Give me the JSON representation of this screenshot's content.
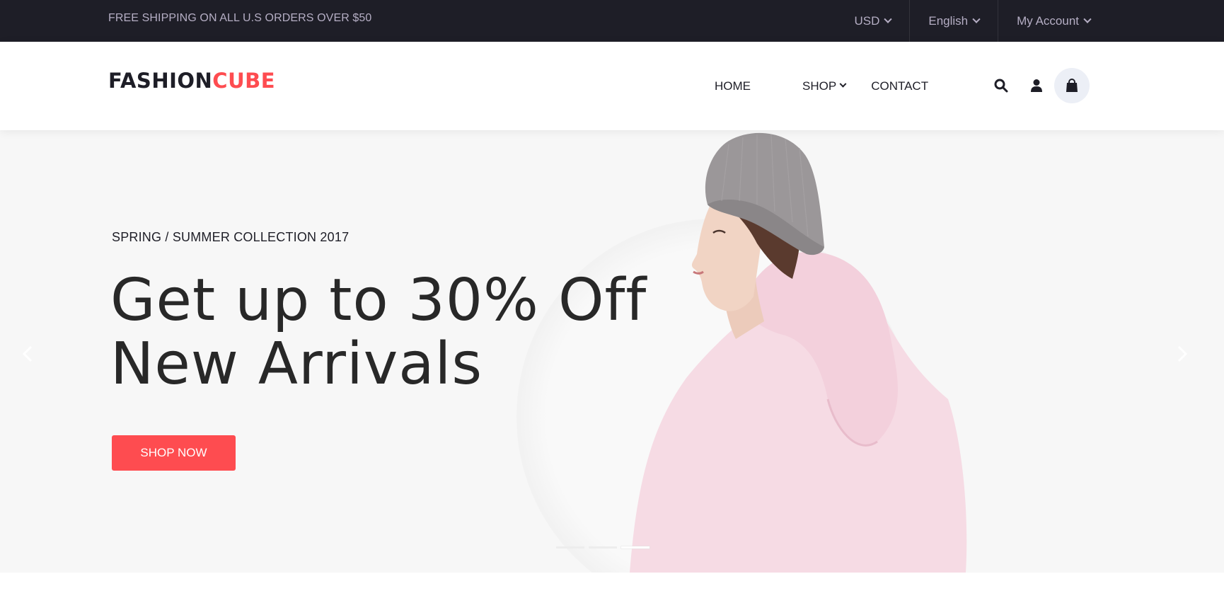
{
  "topbar": {
    "shipping_text": "FREE SHIPPING ON ALL U.S ORDERS OVER $50",
    "currency": "USD",
    "language": "English",
    "account": "My Account"
  },
  "header": {
    "logo_part1": "FASHION",
    "logo_part2": "CUBE",
    "nav": {
      "home": "HOME",
      "shop": "SHOP",
      "contact": "CONTACT"
    }
  },
  "hero": {
    "subtitle": "SPRING / SUMMER COLLECTION 2017",
    "headline_line1": "Get up to 30% Off",
    "headline_line2": "New Arrivals",
    "cta_label": "SHOP NOW",
    "slides_count": 3,
    "active_slide": 3
  },
  "colors": {
    "accent": "#fe4c50",
    "dark": "#1e1e27",
    "topbar_text": "#b5aec4",
    "hero_bg": "#f7f7f7"
  },
  "icons": [
    "chevron-down-icon",
    "search-icon",
    "user-icon",
    "shopping-bag-icon",
    "chevron-left-icon",
    "chevron-right-icon"
  ]
}
